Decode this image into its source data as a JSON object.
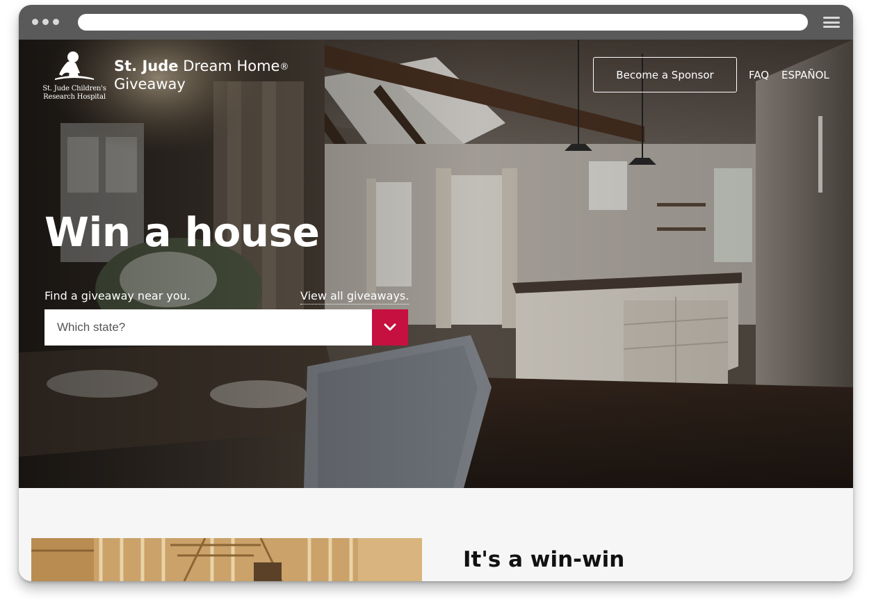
{
  "brand": {
    "logo_line1": "St. Jude Children's",
    "logo_line2": "Research Hospital",
    "name_bold": "St. Jude",
    "name_regular": "Dream Home",
    "reg_mark": "®",
    "name_line2": "Giveaway"
  },
  "nav": {
    "sponsor_label": "Become a Sponsor",
    "faq_label": "FAQ",
    "espanol_label": "ESPAÑOL"
  },
  "hero": {
    "headline": "Win a house",
    "find_label": "Find a giveaway near you.",
    "view_all_label": "View all giveaways.",
    "state_placeholder": "Which state?"
  },
  "section": {
    "title": "It's a win-win"
  },
  "colors": {
    "accent": "#c6103f",
    "chrome": "#5a5a5a",
    "section_bg": "#f6f6f6"
  },
  "icons": {
    "dropdown": "chevron-down-icon",
    "menu": "hamburger-menu-icon",
    "logo": "st-jude-child-figure-icon"
  }
}
